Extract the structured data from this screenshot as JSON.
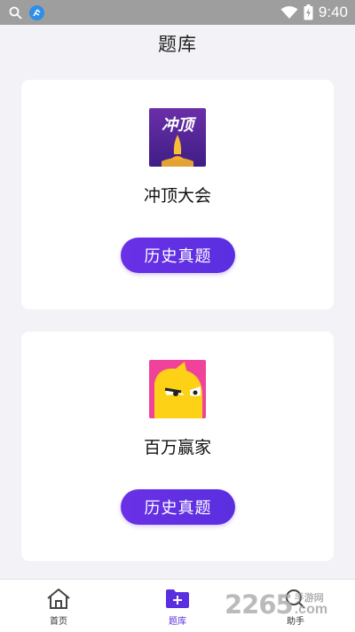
{
  "status_bar": {
    "time": "9:40"
  },
  "page": {
    "title": "题库"
  },
  "cards": [
    {
      "name": "冲顶大会",
      "logo_text": "冲顶",
      "button_label": "历史真题",
      "logo_color": "#5a2a9a"
    },
    {
      "name": "百万赢家",
      "button_label": "历史真题",
      "logo_color": "#f0429a"
    }
  ],
  "bottom_nav": {
    "items": [
      {
        "label": "首页",
        "icon": "home-icon"
      },
      {
        "label": "题库",
        "icon": "folder-add-icon",
        "active": true
      },
      {
        "label": "助手",
        "icon": "search-icon"
      }
    ]
  },
  "watermark": {
    "number": "2265",
    "cn": "手游网",
    "com": ".com"
  },
  "colors": {
    "accent": "#5a2fe0",
    "background": "#f3f3f7"
  }
}
